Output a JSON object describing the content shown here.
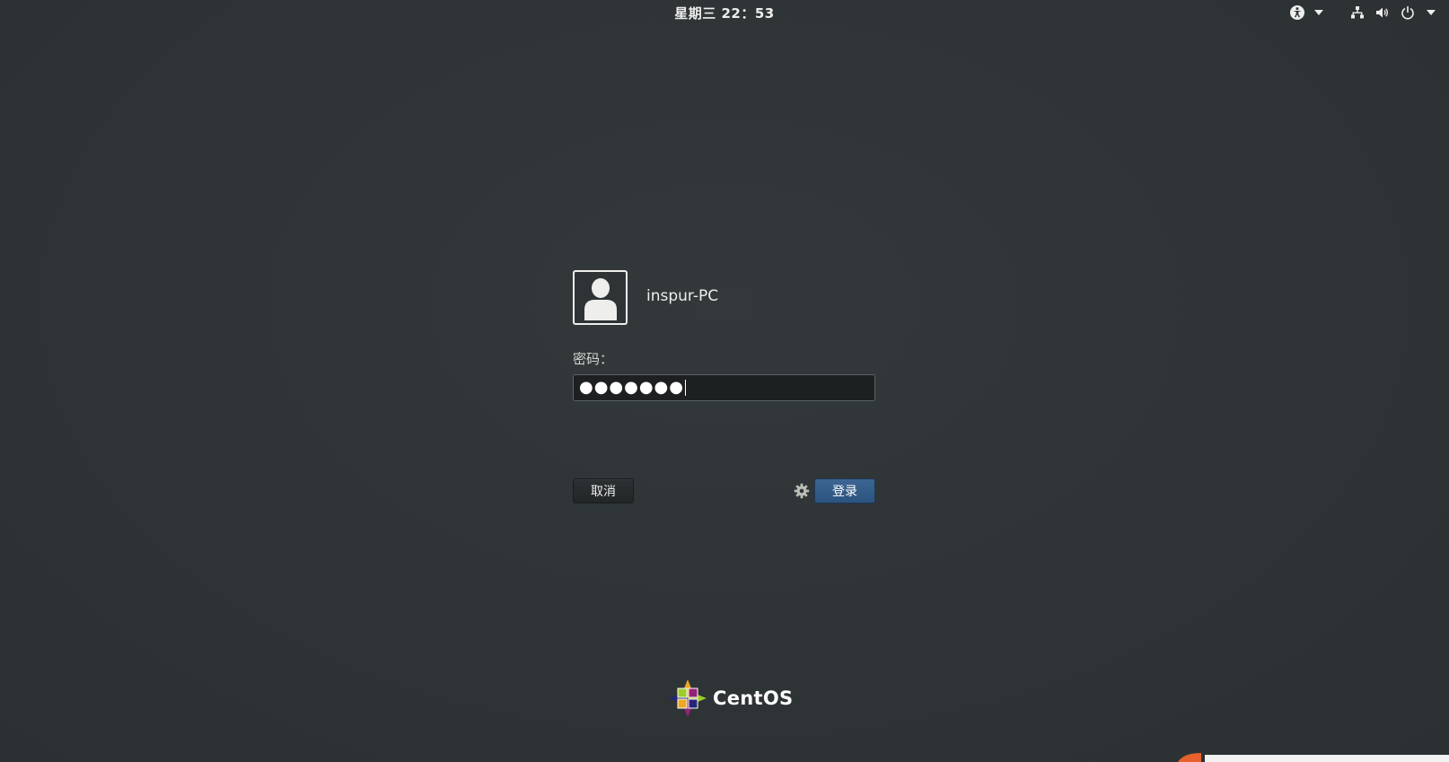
{
  "topbar": {
    "clock": "星期三 22：53",
    "icons": {
      "accessibility": "accessibility-icon",
      "network": "network-wired-icon",
      "volume": "volume-icon",
      "power": "power-icon"
    }
  },
  "login": {
    "username": "inspur-PC",
    "password_label": "密码：",
    "password_value": "●●●●●●●",
    "cancel_label": "取消",
    "login_label": "登录",
    "avatar_icon": "user-avatar-icon",
    "session_icon": "gear-icon"
  },
  "branding": {
    "logo_text": "CentOS",
    "logo_icon": "centos-logo-icon"
  },
  "colors": {
    "background": "#2e3436",
    "login_button": "#335c88",
    "text": "#eeeeec"
  }
}
